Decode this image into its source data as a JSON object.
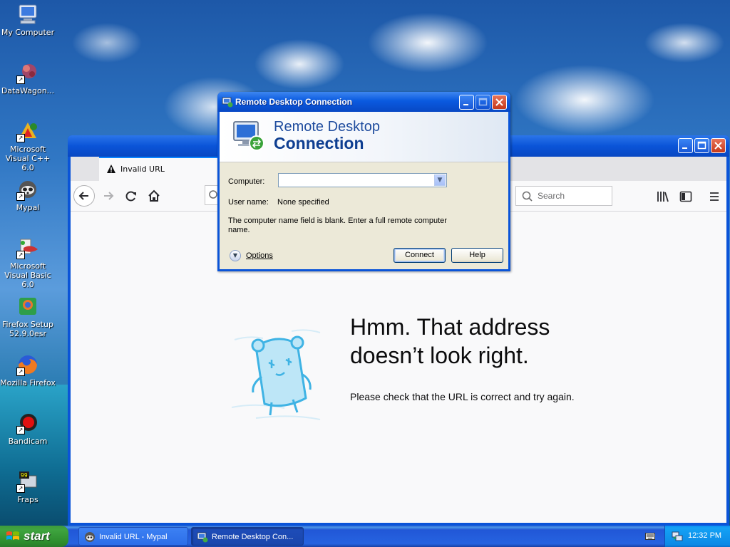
{
  "desktop": {
    "icons": [
      {
        "name": "my-computer",
        "label": "My Computer"
      },
      {
        "name": "datawagon",
        "label": "DataWagon..."
      },
      {
        "name": "ms-visual-cpp",
        "label": "Microsoft Visual C++ 6.0"
      },
      {
        "name": "mypal",
        "label": "Mypal"
      },
      {
        "name": "ms-visual-basic",
        "label": "Microsoft Visual Basic 6.0"
      },
      {
        "name": "firefox-setup",
        "label": "Firefox Setup 52.9.0esr"
      },
      {
        "name": "mozilla-firefox",
        "label": "Mozilla Firefox"
      },
      {
        "name": "bandicam",
        "label": "Bandicam"
      },
      {
        "name": "fraps",
        "label": "Fraps"
      }
    ]
  },
  "browser": {
    "tab_title": "Invalid URL",
    "search_placeholder": "Search",
    "error_title": "Hmm. That address doesn’t look right.",
    "error_description": "Please check that the URL is correct and try again."
  },
  "rdp_dialog": {
    "title": "Remote Desktop Connection",
    "banner_line1": "Remote Desktop",
    "banner_line2": "Connection",
    "computer_label": "Computer:",
    "computer_value": "",
    "username_label": "User name:",
    "username_value": "None specified",
    "message": "The computer name field is blank. Enter a full remote computer name.",
    "options_label": "Options",
    "connect_label": "Connect",
    "help_label": "Help"
  },
  "taskbar": {
    "start_label": "start",
    "tasks": [
      {
        "label": "Invalid URL - Mypal",
        "active": false
      },
      {
        "label": "Remote Desktop Con...",
        "active": true
      }
    ],
    "clock": "12:32 PM"
  }
}
